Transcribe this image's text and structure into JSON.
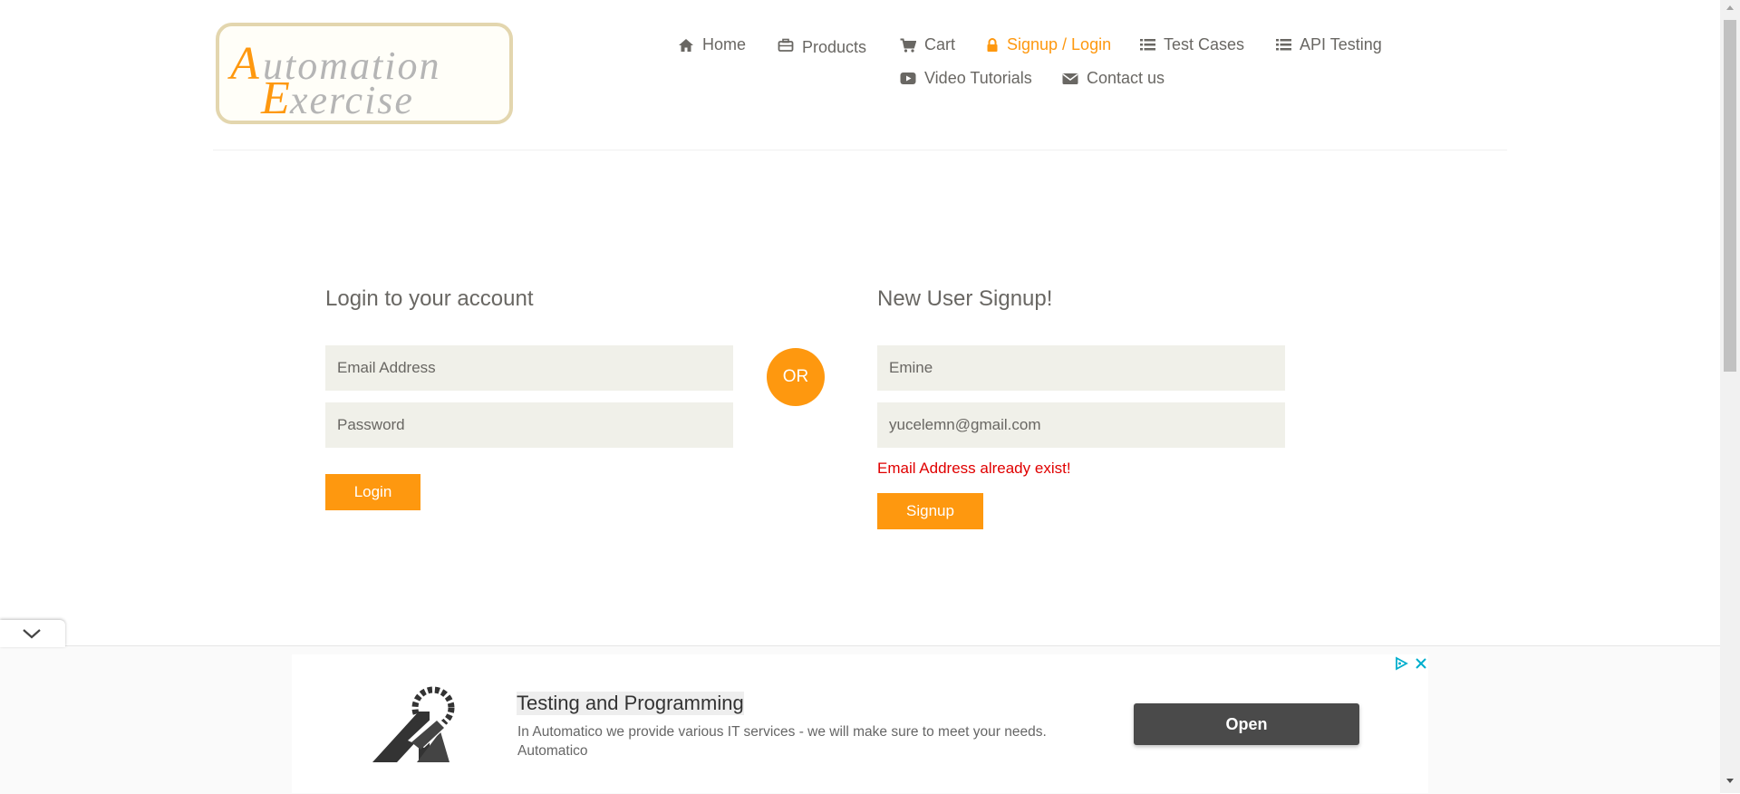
{
  "brand": {
    "logo_text_line1": "Automation",
    "logo_text_line2": "Exercise",
    "accent_color": "#FE980F"
  },
  "nav": {
    "items": [
      {
        "label": "Home",
        "icon": "home-icon"
      },
      {
        "label": "Products",
        "icon": "briefcase-icon"
      },
      {
        "label": "Cart",
        "icon": "cart-icon"
      },
      {
        "label": "Signup / Login",
        "icon": "lock-icon",
        "active": true
      },
      {
        "label": "Test Cases",
        "icon": "list-icon"
      },
      {
        "label": "API Testing",
        "icon": "list-icon"
      },
      {
        "label": "Video Tutorials",
        "icon": "youtube-play-icon"
      },
      {
        "label": "Contact us",
        "icon": "envelope-icon"
      }
    ]
  },
  "login": {
    "title": "Login to your account",
    "email_placeholder": "Email Address",
    "password_placeholder": "Password",
    "button_label": "Login"
  },
  "divider": {
    "label": "OR"
  },
  "signup": {
    "title": "New User Signup!",
    "name_value": "Emine",
    "email_value": "yucelemn@gmail.com",
    "error_message": "Email Address already exist!",
    "button_label": "Signup",
    "error_color": "#e00000"
  },
  "ad": {
    "title": "Testing and Programming",
    "description": "In Automatico we provide various IT services - we will make sure to meet your needs. Automatico",
    "open_label": "Open",
    "choices_icon": "ad-choices-icon",
    "close_icon": "close-icon"
  }
}
